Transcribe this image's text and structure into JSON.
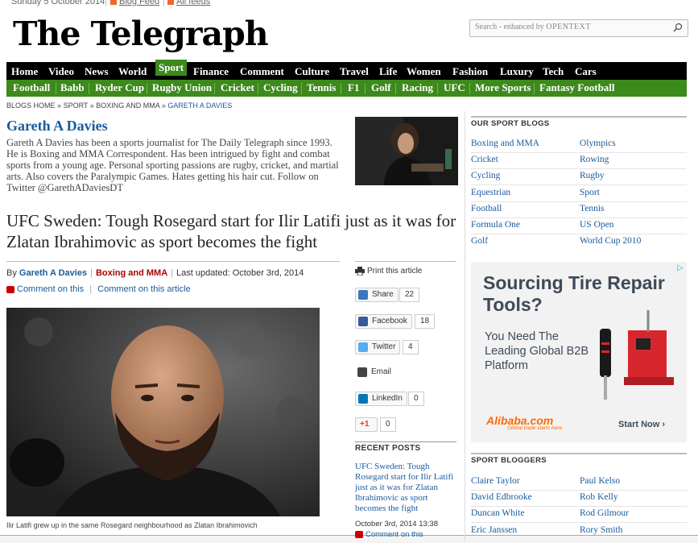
{
  "topbar": {
    "date": "Sunday 5 October 2014",
    "blog_feed": "Blog Feed",
    "all_feeds": "All feeds"
  },
  "masthead": {
    "logo": "The Telegraph",
    "search_placeholder_prefix": "Search - enhanced by ",
    "search_placeholder_brand": "OPENTEXT"
  },
  "nav": {
    "items": [
      "Home",
      "Video",
      "News",
      "World",
      "Sport",
      "Finance",
      "Comment",
      "Culture",
      "Travel",
      "Life",
      "Women",
      "Fashion",
      "Luxury",
      "Tech",
      "Cars"
    ],
    "active": "Sport"
  },
  "subnav": {
    "items": [
      "Football",
      "Babb",
      "Ryder Cup",
      "Rugby Union",
      "Cricket",
      "Cycling",
      "Tennis",
      "F1",
      "Golf",
      "Racing",
      "UFC",
      "More Sports",
      "Fantasy Football"
    ]
  },
  "breadcrumb": {
    "items": [
      "BLOGS HOME",
      "SPORT",
      "BOXING AND MMA",
      "GARETH A DAVIES"
    ],
    "separator": "»"
  },
  "author": {
    "name": "Gareth A Davies",
    "bio": "Gareth A Davies has been a sports journalist for The Daily Telegraph since 1993. He is Boxing and MMA Correspondent. Has been intrigued by fight and combat sports from a young age. Personal sporting passions are rugby, cricket, and martial arts. Also covers the Paralympic Games. Hates getting his hair cut. Follow on Twitter @GarethADaviesDT"
  },
  "article": {
    "headline": "UFC Sweden: Tough Rosegard start for Ilir Latifi just as it was for Zlatan Ibrahimovic as sport becomes the fight",
    "by": "By",
    "author": "Gareth A Davies",
    "category": "Boxing and MMA",
    "updated": "Last updated: October 3rd, 2014",
    "comment_on_this": "Comment on this",
    "comment_on_article": "Comment on this article",
    "caption": "Ilir Latifi grew up in the same Rosegard neighbourhood as Zlatan Ibrahimovich"
  },
  "share": {
    "print": "Print this article",
    "share_label": "Share",
    "share_count": "22",
    "facebook_label": "Facebook",
    "facebook_count": "18",
    "twitter_label": "Twitter",
    "twitter_count": "4",
    "email_label": "Email",
    "linkedin_label": "LinkedIn",
    "linkedin_count": "0",
    "gplus_label": "+1",
    "gplus_count": "0"
  },
  "recent": {
    "title": "RECENT POSTS",
    "post_title": "UFC Sweden: Tough Rosegard start for Ilir Latifi just as it was for Zlatan Ibrahimovic as sport becomes the fight",
    "post_date": "October 3rd, 2014 13:38",
    "post_comment": "Comment on this"
  },
  "sidebar": {
    "blogs_title": "OUR SPORT BLOGS",
    "blogs_left": [
      "Boxing and MMA",
      "Cricket",
      "Cycling",
      "Equestrian",
      "Football",
      "Formula One",
      "Golf"
    ],
    "blogs_right": [
      "Olympics",
      "Rowing",
      "Rugby",
      "Sport",
      "Tennis",
      "US Open",
      "World Cup 2010"
    ],
    "bloggers_title": "SPORT BLOGGERS",
    "bloggers_left": [
      "Claire Taylor",
      "David Edbrooke",
      "Duncan White",
      "Eric Janssen"
    ],
    "bloggers_right": [
      "Paul Kelso",
      "Rob Kelly",
      "Rod Gilmour",
      "Rory Smith"
    ]
  },
  "ad": {
    "headline": "Sourcing Tire Repair Tools?",
    "sub": "You Need The Leading Global B2B Platform",
    "logo": "Alibaba.com",
    "logo_tag": "Global trade starts here.",
    "cta": "Start Now ›"
  },
  "colors": {
    "nav_bg": "#000000",
    "sport_green": "#3c8a1b",
    "link_blue": "#1a5a9b",
    "category_red": "#aa0000"
  }
}
